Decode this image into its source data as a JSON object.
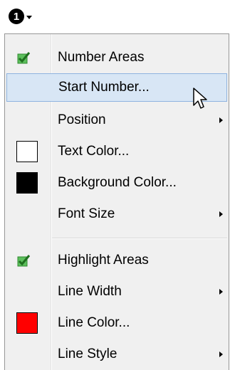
{
  "toolbar": {
    "badge_number": "1"
  },
  "menu": {
    "items": [
      {
        "label": "Number Areas",
        "checked": true,
        "icon": "check-icon"
      },
      {
        "label": "Start Number...",
        "hover": true
      },
      {
        "label": "Position",
        "submenu": true
      },
      {
        "label": "Text Color...",
        "swatch": "#ffffff"
      },
      {
        "label": "Background Color...",
        "swatch": "#000000"
      },
      {
        "label": "Font Size",
        "submenu": true
      },
      {
        "label": "Highlight Areas",
        "checked": true,
        "icon": "check-icon"
      },
      {
        "label": "Line Width",
        "submenu": true
      },
      {
        "label": "Line Color...",
        "swatch": "#ff0000"
      },
      {
        "label": "Line Style",
        "submenu": true
      }
    ]
  },
  "colors": {
    "menu_background": "#f0f0f0",
    "hover_background": "#d8e6f5",
    "hover_border": "#8fb3df",
    "check_green": "#3aa53a",
    "text_color_swatch": "#ffffff",
    "background_color_swatch": "#000000",
    "line_color_swatch": "#ff0000"
  }
}
